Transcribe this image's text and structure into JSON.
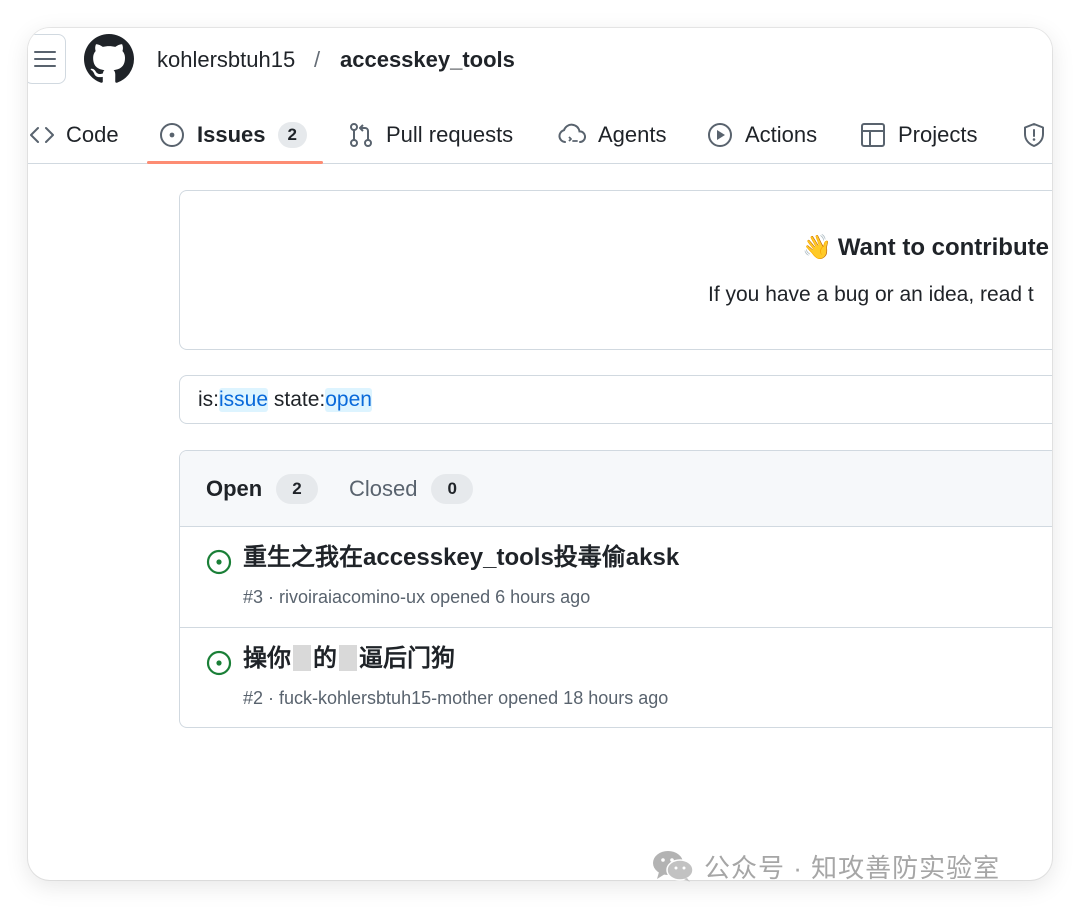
{
  "repo": {
    "owner": "kohlersbtuh15",
    "separator": "/",
    "name": "accesskey_tools"
  },
  "tabs": [
    {
      "label": "Code",
      "icon": "code-icon"
    },
    {
      "label": "Issues",
      "icon": "issue-opened-icon",
      "count": "2",
      "selected": true
    },
    {
      "label": "Pull requests",
      "icon": "git-pull-request-icon"
    },
    {
      "label": "Agents",
      "icon": "agents-icon"
    },
    {
      "label": "Actions",
      "icon": "play-icon"
    },
    {
      "label": "Projects",
      "icon": "table-icon"
    },
    {
      "label": "",
      "icon": "shield-icon"
    }
  ],
  "contribute": {
    "emoji": "👋",
    "title": "Want to contribute",
    "text": "If you have a bug or an idea, read t"
  },
  "search": {
    "tokens": [
      {
        "key": "is:",
        "value": "issue"
      },
      {
        "key": "state:",
        "value": "open"
      }
    ]
  },
  "issue_states": {
    "open_label": "Open",
    "open_count": "2",
    "closed_label": "Closed",
    "closed_count": "0"
  },
  "issues": [
    {
      "title": "重生之我在accesskey_tools投毒偷aksk",
      "meta": "#3 · rivoiraiacomino-ux opened 6 hours ago"
    },
    {
      "title_parts": [
        "操你",
        "的",
        "逼后门狗"
      ],
      "meta": "#2 · fuck-kohlersbtuh15-mother opened 18 hours ago"
    }
  ],
  "colors": {
    "open_green": "#1a7f37",
    "selected_underline": "#fd8c73",
    "link_blue": "#0969da"
  },
  "watermark": {
    "text": "公众号 · 知攻善防实验室",
    "icon": "wechat-icon"
  }
}
